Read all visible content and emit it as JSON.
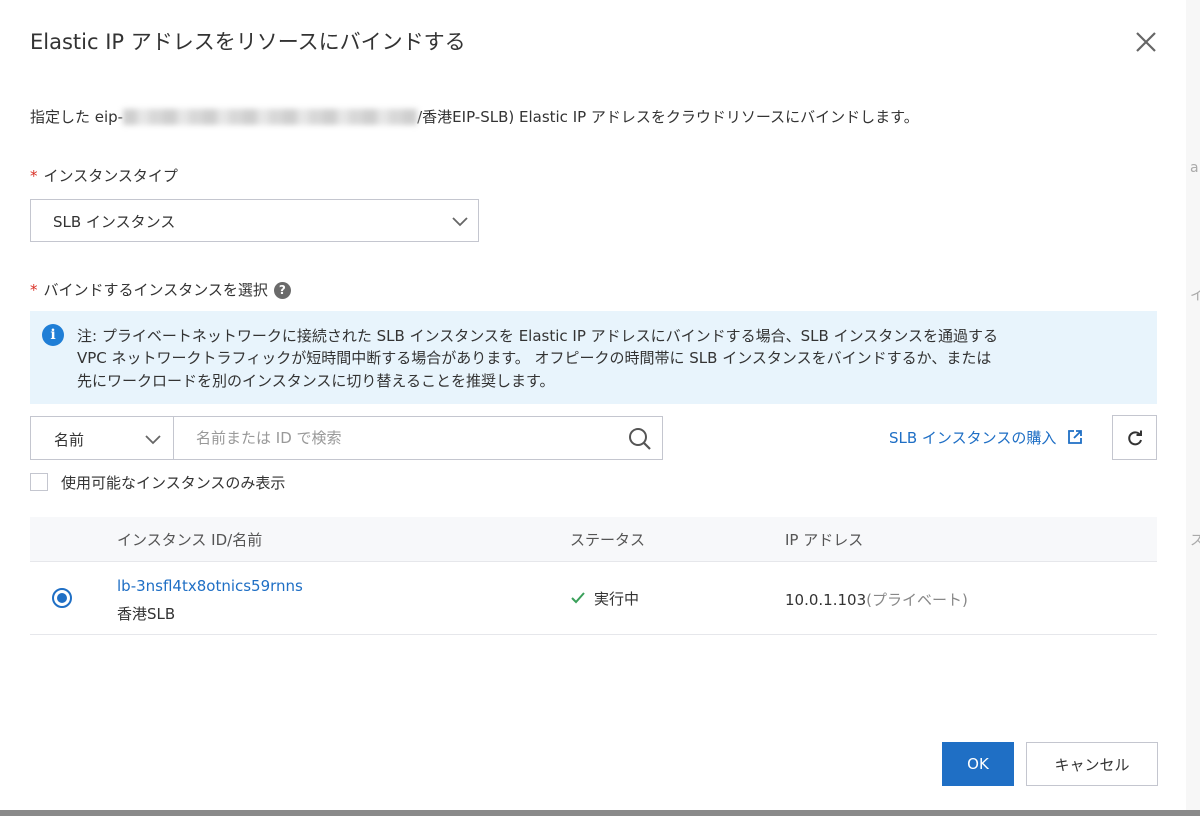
{
  "dialog": {
    "title": "Elastic IP アドレスをリソースにバインドする",
    "description_prefix": "指定した eip-",
    "description_suffix": "/香港EIP-SLB) Elastic IP アドレスをクラウドリソースにバインドします。"
  },
  "instance_type": {
    "label": "インスタンスタイプ",
    "value": "SLB インスタンス"
  },
  "select_instance": {
    "label": "バインドするインスタンスを選択",
    "help_glyph": "?"
  },
  "notice": {
    "line1": "注: プライベートネットワークに接続された SLB インスタンスを Elastic IP アドレスにバインドする場合、SLB インスタンスを通過する",
    "line2": "VPC ネットワークトラフィックが短時間中断する場合があります。 オフピークの時間帯に SLB インスタンスをバインドするか、または",
    "line3": "先にワークロードを別のインスタンスに切り替えることを推奨します。"
  },
  "filter": {
    "field": "名前",
    "placeholder": "名前または ID で検索"
  },
  "buy_link": "SLB インスタンスの購入",
  "checkbox_label": "使用可能なインスタンスのみ表示",
  "table": {
    "headers": [
      "インスタンス ID/名前",
      "ステータス",
      "IP アドレス"
    ],
    "rows": [
      {
        "id": "lb-3nsfl4tx8otnics59rnns",
        "name": "香港SLB",
        "status": "実行中",
        "ip": "10.0.1.103",
        "ip_type": "(プライベート)",
        "selected": true
      }
    ]
  },
  "buttons": {
    "ok": "OK",
    "cancel": "キャンセル"
  },
  "colors": {
    "primary": "#1f6fc5",
    "required": "#d93026",
    "success": "#3aa05a",
    "notice_bg": "#e8f4fc"
  }
}
